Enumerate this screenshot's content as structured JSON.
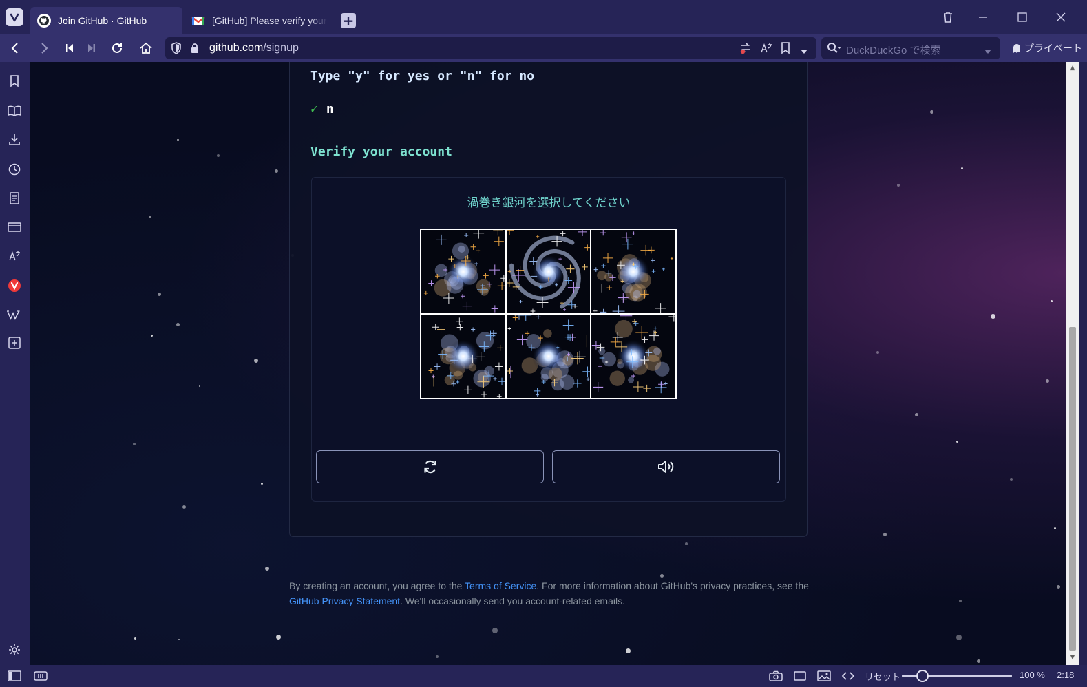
{
  "browser": {
    "tabs": [
      {
        "title": "Join GitHub · GitHub",
        "active": true
      },
      {
        "title": "[GitHub] Please verify your",
        "active": false
      }
    ],
    "address": {
      "host": "github.com",
      "path": "/signup"
    },
    "search_placeholder": "DuckDuckGo で検索",
    "private_label": "プライベート"
  },
  "page": {
    "prompt": "Type \"y\" for yes or \"n\" for no",
    "answer": "n",
    "verify_heading": "Verify your account",
    "captcha": {
      "instruction": "渦巻き銀河を選択してください",
      "tiles": [
        "galaxy-tile-1",
        "galaxy-tile-2",
        "galaxy-tile-3",
        "galaxy-tile-4",
        "galaxy-tile-5",
        "galaxy-tile-6"
      ]
    },
    "legal": {
      "part1": "By creating an account, you agree to the ",
      "terms_link": "Terms of Service",
      "part2": ". For more information about GitHub's privacy practices, see the ",
      "privacy_link": "GitHub Privacy Statement",
      "part3": ". We'll occasionally send you account-related emails."
    }
  },
  "statusbar": {
    "reset_label": "リセット",
    "zoom": "100 %",
    "clock": "2:18"
  },
  "colors": {
    "accent_heading": "#7ee2d0",
    "link": "#4493f8",
    "check": "#3fb950"
  }
}
